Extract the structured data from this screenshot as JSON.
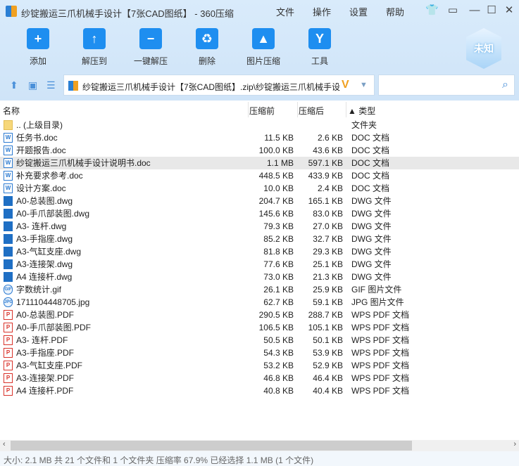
{
  "window": {
    "title": "纱锭搬运三爪机械手设计【7张CAD图纸】 - 360压缩",
    "menus": [
      "文件",
      "操作",
      "设置",
      "帮助"
    ]
  },
  "toolbar": {
    "items": [
      {
        "label": "添加",
        "icon": "+"
      },
      {
        "label": "解压到",
        "icon": "↑"
      },
      {
        "label": "一键解压",
        "icon": "−"
      },
      {
        "label": "删除",
        "icon": "♻"
      },
      {
        "label": "图片压缩",
        "icon": "▲"
      },
      {
        "label": "工具",
        "icon": "Y"
      }
    ],
    "badge": "未知"
  },
  "address": {
    "path": "纱锭搬运三爪机械手设计【7张CAD图纸】.zip\\纱锭搬运三爪机械手设",
    "search_placeholder": ""
  },
  "columns": {
    "name": "名称",
    "before": "压缩前",
    "after": "压缩后",
    "type": "▲ 类型"
  },
  "files": [
    {
      "name": ".. (上级目录)",
      "before": "",
      "after": "",
      "type": "文件夹",
      "kind": "folder"
    },
    {
      "name": "任务书.doc",
      "before": "11.5 KB",
      "after": "2.6 KB",
      "type": "DOC 文档",
      "kind": "doc"
    },
    {
      "name": "开题报告.doc",
      "before": "100.0 KB",
      "after": "43.6 KB",
      "type": "DOC 文档",
      "kind": "doc"
    },
    {
      "name": "纱锭搬运三爪机械手设计说明书.doc",
      "before": "1.1 MB",
      "after": "597.1 KB",
      "type": "DOC 文档",
      "kind": "doc",
      "selected": true
    },
    {
      "name": "补充要求参考.doc",
      "before": "448.5 KB",
      "after": "433.9 KB",
      "type": "DOC 文档",
      "kind": "doc"
    },
    {
      "name": "设计方案.doc",
      "before": "10.0 KB",
      "after": "2.4 KB",
      "type": "DOC 文档",
      "kind": "doc"
    },
    {
      "name": "A0-总装图.dwg",
      "before": "204.7 KB",
      "after": "165.1 KB",
      "type": "DWG 文件",
      "kind": "dwg"
    },
    {
      "name": "A0-手爪部装图.dwg",
      "before": "145.6 KB",
      "after": "83.0 KB",
      "type": "DWG 文件",
      "kind": "dwg"
    },
    {
      "name": "A3- 连杆.dwg",
      "before": "79.3 KB",
      "after": "27.0 KB",
      "type": "DWG 文件",
      "kind": "dwg"
    },
    {
      "name": "A3-手指座.dwg",
      "before": "85.2 KB",
      "after": "32.7 KB",
      "type": "DWG 文件",
      "kind": "dwg"
    },
    {
      "name": "A3-气缸支座.dwg",
      "before": "81.8 KB",
      "after": "29.3 KB",
      "type": "DWG 文件",
      "kind": "dwg"
    },
    {
      "name": "A3-连接架.dwg",
      "before": "77.6 KB",
      "after": "25.1 KB",
      "type": "DWG 文件",
      "kind": "dwg"
    },
    {
      "name": "A4 连接杆.dwg",
      "before": "73.0 KB",
      "after": "21.3 KB",
      "type": "DWG 文件",
      "kind": "dwg"
    },
    {
      "name": "字数统计.gif",
      "before": "26.1 KB",
      "after": "25.9 KB",
      "type": "GIF 图片文件",
      "kind": "gif"
    },
    {
      "name": "1711104448705.jpg",
      "before": "62.7 KB",
      "after": "59.1 KB",
      "type": "JPG 图片文件",
      "kind": "jpg"
    },
    {
      "name": "A0-总装图.PDF",
      "before": "290.5 KB",
      "after": "288.7 KB",
      "type": "WPS PDF 文档",
      "kind": "pdf"
    },
    {
      "name": "A0-手爪部装图.PDF",
      "before": "106.5 KB",
      "after": "105.1 KB",
      "type": "WPS PDF 文档",
      "kind": "pdf"
    },
    {
      "name": "A3- 连杆.PDF",
      "before": "50.5 KB",
      "after": "50.1 KB",
      "type": "WPS PDF 文档",
      "kind": "pdf"
    },
    {
      "name": "A3-手指座.PDF",
      "before": "54.3 KB",
      "after": "53.9 KB",
      "type": "WPS PDF 文档",
      "kind": "pdf"
    },
    {
      "name": "A3-气缸支座.PDF",
      "before": "53.2 KB",
      "after": "52.9 KB",
      "type": "WPS PDF 文档",
      "kind": "pdf"
    },
    {
      "name": "A3-连接架.PDF",
      "before": "46.8 KB",
      "after": "46.4 KB",
      "type": "WPS PDF 文档",
      "kind": "pdf"
    },
    {
      "name": "A4 连接杆.PDF",
      "before": "40.8 KB",
      "after": "40.4 KB",
      "type": "WPS PDF 文档",
      "kind": "pdf"
    }
  ],
  "status": "大小: 2.1 MB 共 21 个文件和 1 个文件夹 压缩率 67.9% 已经选择 1.1 MB (1 个文件)"
}
